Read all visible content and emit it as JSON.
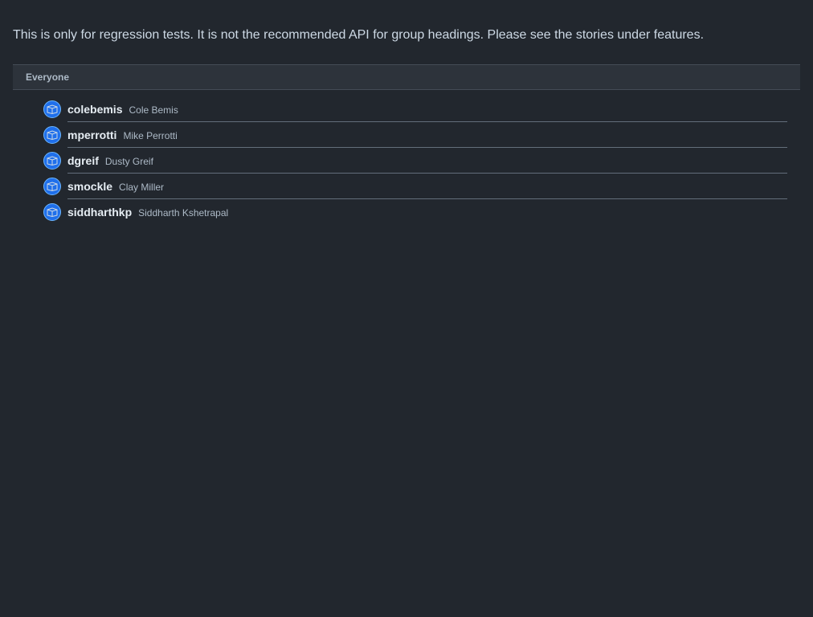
{
  "intro_text": "This is only for regression tests. It is not the recommended API for group headings. Please see the stories under features.",
  "group": {
    "heading": "Everyone",
    "items": [
      {
        "login": "colebemis",
        "name": "Cole Bemis",
        "icon": "avatar-icon"
      },
      {
        "login": "mperrotti",
        "name": "Mike Perrotti",
        "icon": "avatar-icon"
      },
      {
        "login": "dgreif",
        "name": "Dusty Greif",
        "icon": "avatar-icon"
      },
      {
        "login": "smockle",
        "name": "Clay Miller",
        "icon": "avatar-icon"
      },
      {
        "login": "siddharthkp",
        "name": "Siddharth Kshetrapal",
        "icon": "avatar-icon"
      }
    ]
  },
  "colors": {
    "background": "#22272e",
    "header_bg": "#2d333b",
    "avatar_bg": "#1f6feb"
  }
}
